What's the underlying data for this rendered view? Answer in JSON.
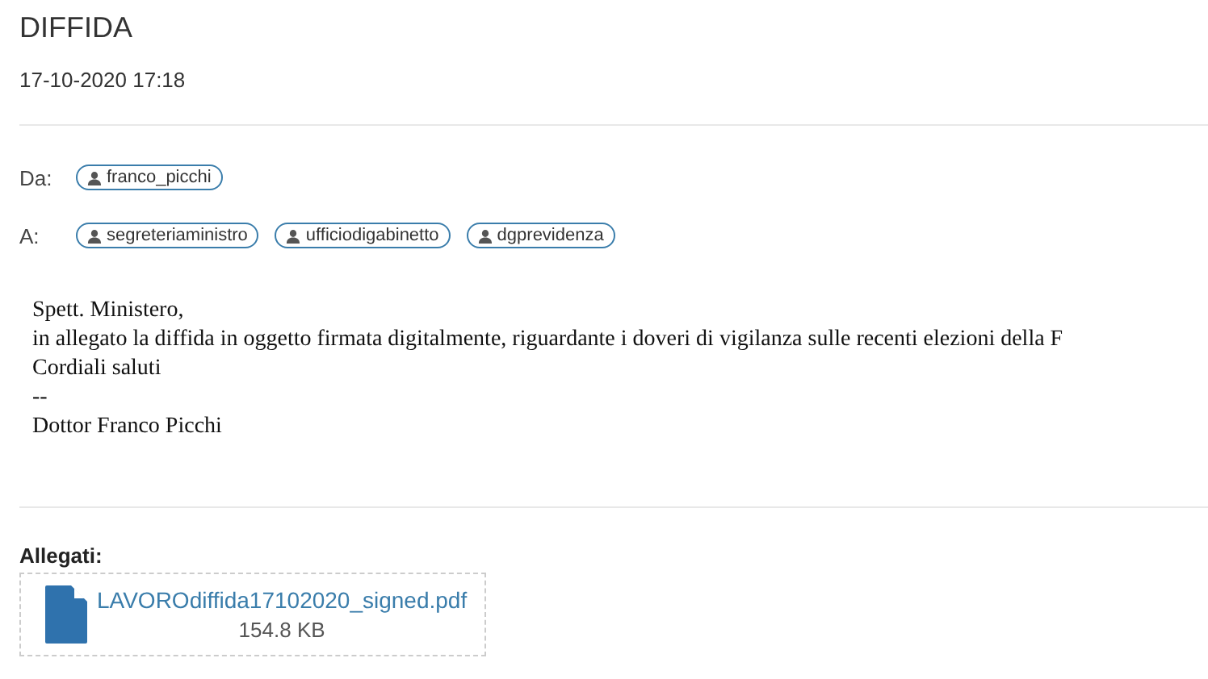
{
  "subject": "DIFFIDA",
  "date": "17-10-2020 17:18",
  "from": {
    "label": "Da:",
    "recipients": [
      "franco_picchi"
    ]
  },
  "to": {
    "label": "A:",
    "recipients": [
      "segreteriaministro",
      "ufficiodigabinetto",
      "dgprevidenza"
    ]
  },
  "body": [
    "Spett. Ministero,",
    "in allegato la diffida in oggetto firmata digitalmente, riguardante i doveri di vigilanza sulle recenti elezioni della F",
    "Cordiali saluti",
    "--",
    "Dottor Franco Picchi"
  ],
  "attachments": {
    "label": "Allegati:",
    "files": [
      {
        "name": "LAVOROdiffida17102020_signed.pdf",
        "size": "154.8 KB"
      }
    ]
  }
}
